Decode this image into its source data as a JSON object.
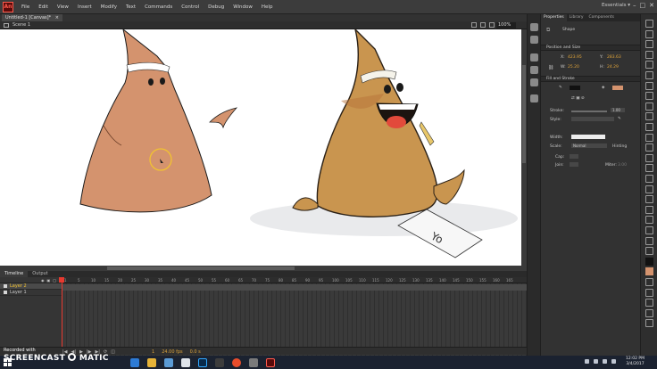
{
  "app": {
    "logo": "An",
    "menu": [
      "File",
      "Edit",
      "View",
      "Insert",
      "Modify",
      "Text",
      "Commands",
      "Control",
      "Debug",
      "Window",
      "Help"
    ],
    "workspace": "Essentials ▾"
  },
  "document": {
    "tab_title": "Untitled-1 [Canvas]*",
    "scene": "Scene 1",
    "zoom": "100%"
  },
  "timeline": {
    "tabs": [
      "Timeline",
      "Output"
    ],
    "layers": [
      "Layer 2",
      "Layer 1"
    ],
    "ruler": [
      "1",
      "5",
      "10",
      "15",
      "20",
      "25",
      "30",
      "35",
      "40",
      "45",
      "50",
      "55",
      "60",
      "65",
      "70",
      "75",
      "80",
      "85",
      "90",
      "95",
      "100",
      "105",
      "110",
      "115",
      "120",
      "125",
      "130",
      "135",
      "140",
      "145",
      "150",
      "155",
      "160",
      "165"
    ],
    "frame": "1",
    "fps": "24.00 fps",
    "time": "0.0 s"
  },
  "properties": {
    "tabs": [
      "Properties",
      "Library",
      "Components"
    ],
    "object_type": "Shape",
    "pos_section": "Position and Size",
    "x_label": "X:",
    "x_value": "423.95",
    "y_label": "Y:",
    "y_value": "283.63",
    "w_label": "W:",
    "w_value": "25.20",
    "h_label": "H:",
    "h_value": "24.29",
    "fill_section": "Fill and Stroke",
    "stroke_label": "Stroke:",
    "stroke_value": "1.00",
    "style_label": "Style:",
    "width_label": "Width:",
    "scale_label": "Scale:",
    "scale_value": "Normal",
    "hinting_label": "Hinting",
    "cap_label": "Cap:",
    "join_label": "Join:",
    "miter_label": "Miter:",
    "miter_value": "3.00",
    "stroke_color": "#111111",
    "fill_color": "#d4936e"
  },
  "taskbar": {
    "time": "12:02 PM",
    "date": "3/4/2017"
  },
  "watermark": {
    "line1": "Recorded with",
    "line2a": "SCREENCAST",
    "line2b": "MATIC"
  }
}
